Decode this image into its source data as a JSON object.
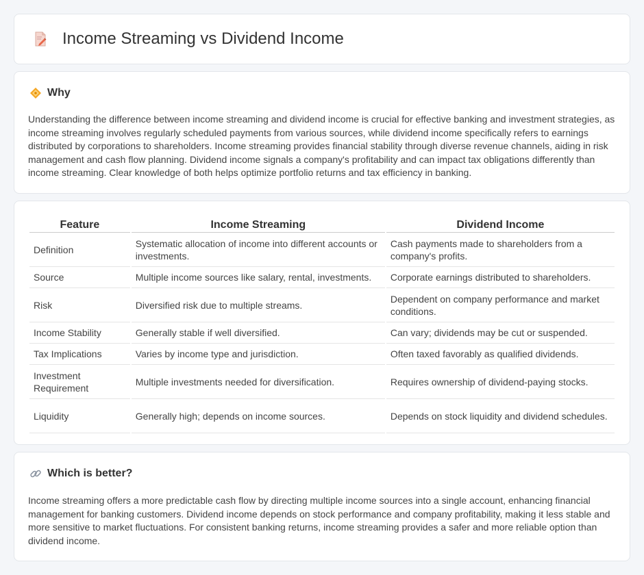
{
  "header": {
    "title": "Income Streaming vs Dividend Income",
    "icon": "document-pencil-icon"
  },
  "why": {
    "title": "Why",
    "icon": "diamond-icon",
    "text": "Understanding the difference between income streaming and dividend income is crucial for effective banking and investment strategies, as income streaming involves regularly scheduled payments from various sources, while dividend income specifically refers to earnings distributed by corporations to shareholders. Income streaming provides financial stability through diverse revenue channels, aiding in risk management and cash flow planning. Dividend income signals a company's profitability and can impact tax obligations differently than income streaming. Clear knowledge of both helps optimize portfolio returns and tax efficiency in banking."
  },
  "table": {
    "headers": [
      "Feature",
      "Income Streaming",
      "Dividend Income"
    ],
    "rows": [
      [
        "Definition",
        "Systematic allocation of income into different accounts or investments.",
        "Cash payments made to shareholders from a company's profits."
      ],
      [
        "Source",
        "Multiple income sources like salary, rental, investments.",
        "Corporate earnings distributed to shareholders."
      ],
      [
        "Risk",
        "Diversified risk due to multiple streams.",
        "Dependent on company performance and market conditions."
      ],
      [
        "Income Stability",
        "Generally stable if well diversified.",
        "Can vary; dividends may be cut or suspended."
      ],
      [
        "Tax Implications",
        "Varies by income type and jurisdiction.",
        "Often taxed favorably as qualified dividends."
      ],
      [
        "Investment Requirement",
        "Multiple investments needed for diversification.",
        "Requires ownership of dividend-paying stocks."
      ],
      [
        "Liquidity",
        "Generally high; depends on income sources.",
        "Depends on stock liquidity and dividend schedules."
      ]
    ]
  },
  "better": {
    "title": "Which is better?",
    "icon": "link-icon",
    "text": "Income streaming offers a more predictable cash flow by directing multiple income sources into a single account, enhancing financial management for banking customers. Dividend income depends on stock performance and company profitability, making it less stable and more sensitive to market fluctuations. For consistent banking returns, income streaming provides a safer and more reliable option than dividend income."
  }
}
